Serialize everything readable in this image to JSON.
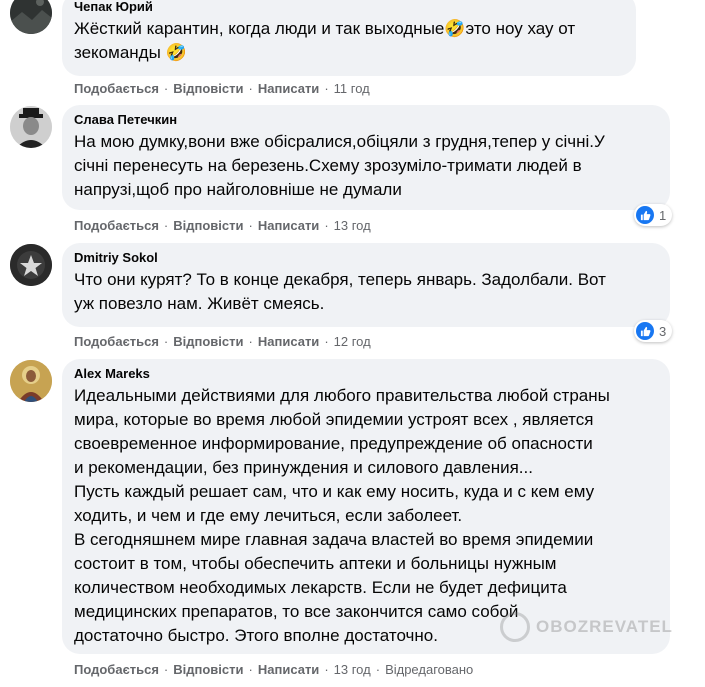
{
  "actions": {
    "like": "Подобається",
    "reply": "Відповісти",
    "message": "Написати",
    "separator": "·"
  },
  "comments": [
    {
      "author": "Чепак Юрий",
      "text": "Жёсткий карантин, когда люди и так выходные🤣это ноу хау от\nзекоманды 🤣",
      "time": "11 год",
      "avatar_icon": "dark-landscape-avatar"
    },
    {
      "author": "Слава Петечкин",
      "text": "На мою думку,вони вже обісралися,обіцяли з грудня,тепер у січні.У\nсічні перенесуть на березень.Схему зрозуміло-тримати людей в\nнапрузі,щоб про найголовніше не думали",
      "time": "13 год",
      "reaction_count": "1",
      "avatar_icon": "man-with-hat-avatar"
    },
    {
      "author": "Dmitriy Sokol",
      "text": "Что они курят? То в конце декабря, теперь январь. Задолбали. Вот\nуж повезло нам. Живёт смеясь.",
      "time": "12 год",
      "reaction_count": "3",
      "avatar_icon": "dark-star-avatar"
    },
    {
      "author": "Alex Mareks",
      "text": "Идеальными действиями для любого правительства любой страны\nмира, которые во время любой эпидемии устроят всех , является\nсвоевременное информирование, предупреждение об опасности\nи рекомендации, без принуждения и силового давления...\nПусть каждый решает сам, что и как ему носить, куда и с кем ему\nходить, и чем и где ему лечиться, если заболеет.\nВ сегодняшнем мире главная задача властей во время эпидемии\nсостоит в том, чтобы обеспечить аптеки и больницы нужным\nколичеством необходимых лекарств. Если не будет дефицита\nмедицинских препаратов, то все закончится само собой\nдостаточно быстро. Этого вполне достаточно.",
      "time": "13 год",
      "edited": "Відредаговано",
      "avatar_icon": "icon-painting-avatar"
    }
  ],
  "watermark": "OBOZREVATEL",
  "colors": {
    "bubble": "#f0f2f5",
    "secondary_text": "#65676b",
    "like_blue": "#1877f2"
  }
}
